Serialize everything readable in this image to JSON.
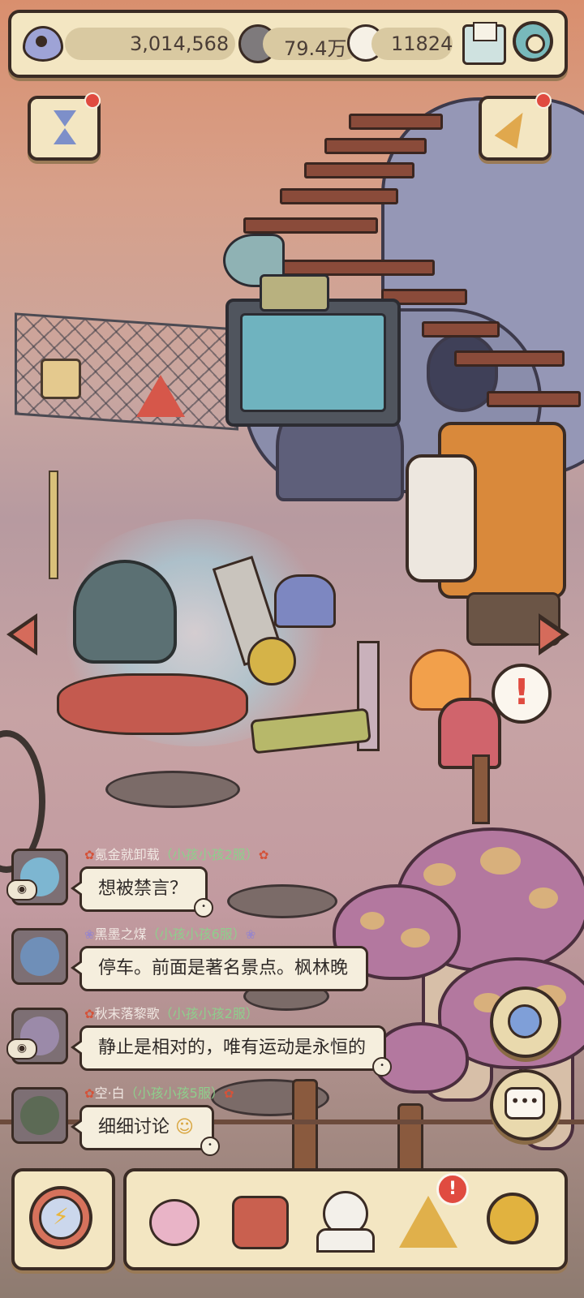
{
  "resources": {
    "eye_count": "3,014,568",
    "soul_count": "79.4万",
    "chat_count": "11824"
  },
  "icons": {
    "eye": "eye-icon",
    "soul": "soul-orb-icon",
    "chat": "speech-bubble-icon",
    "mail": "mail-icon",
    "settings": "gear-icon",
    "hourglass": "hourglass-icon",
    "party": "party-popper-icon",
    "alert": "exclamation-icon"
  },
  "chat": [
    {
      "name": "氪金就卸载",
      "server": "（小孩小孩2服）",
      "message": "想被禁言？",
      "avatar_color": "#7db6d1",
      "has_eye": true
    },
    {
      "name": "黑墨之煤",
      "server": "（小孩小孩6服）",
      "message": "停车。前面是著名景点。枫林晚",
      "avatar_color": "#6f8fb8",
      "has_eye": false
    },
    {
      "name": "秋末落黎歌",
      "server": "（小孩小孩2服）",
      "message": "静止是相对的，唯有运动是永恒的",
      "avatar_color": "#9b8aa9",
      "has_eye": true
    },
    {
      "name": "空·白",
      "server": "（小孩小孩5服）",
      "message": "细细讨论",
      "avatar_color": "#5c6a55",
      "has_eye": false
    }
  ],
  "colors": {
    "panel": "#f3e6c2",
    "outline": "#3a2b24",
    "alert_red": "#e04b40",
    "server_green": "#8ecf8c"
  }
}
